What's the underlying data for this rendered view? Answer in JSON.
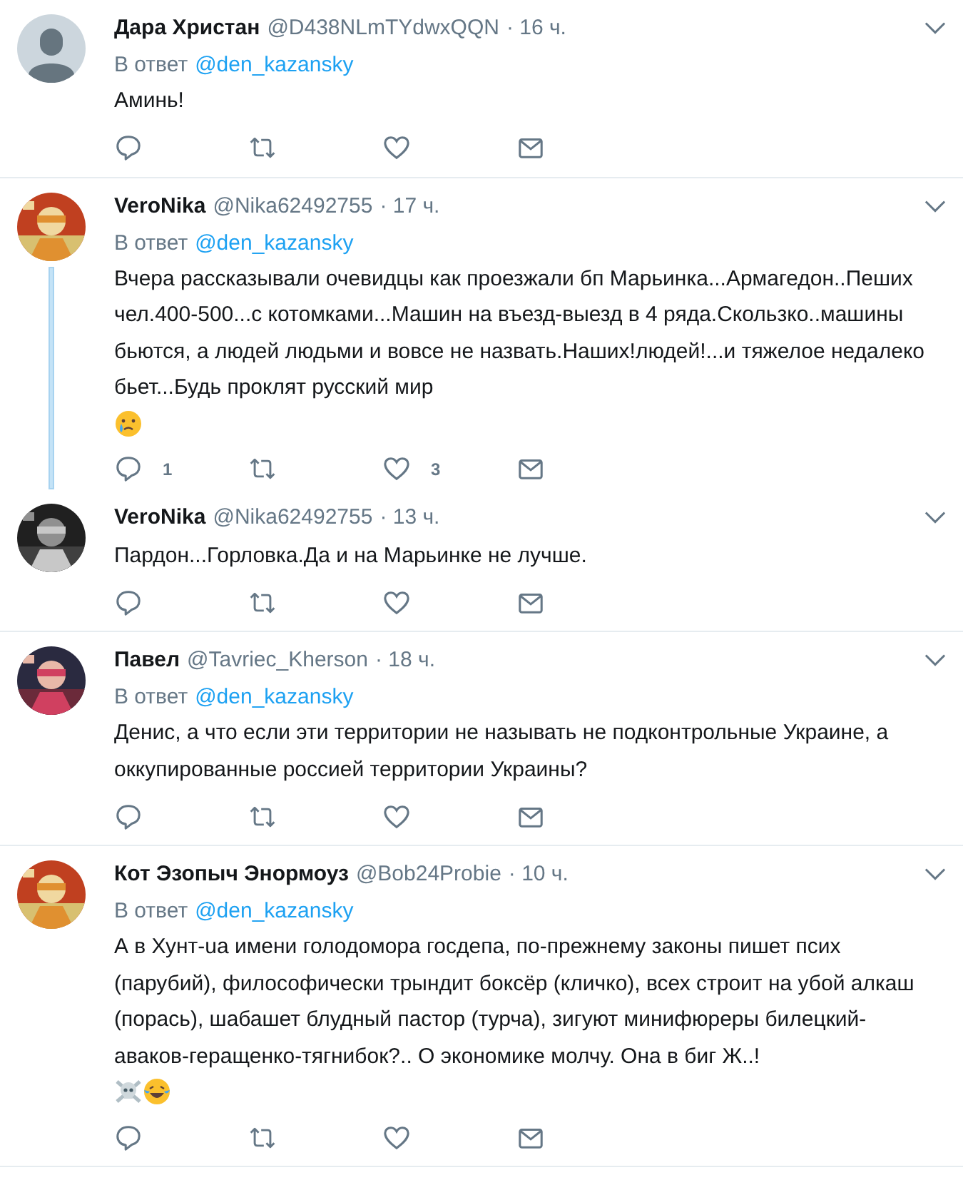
{
  "tweets": [
    {
      "avatar": {
        "kind": "default"
      },
      "name": "Дара Христан",
      "handle": "@D438NLmTYdwxQQN",
      "time": "· 16 ч.",
      "reply_label": "В ответ",
      "reply_to": "@den_kazansky",
      "text": "Аминь!",
      "thread_below": false
    },
    {
      "avatar": {
        "kind": "picture"
      },
      "name": "VeroNika",
      "handle": "@Nika62492755",
      "time": "· 17 ч.",
      "reply_label": "В ответ",
      "reply_to": "@den_kazansky",
      "text": "Вчера рассказывали очевидцы как проезжали бп Марьинка...Армагедон..Пеших чел.400-500...с котомками...Машин на въезд-выезд в 4 ряда.Скользко..машины бьются, а людей людьми и вовсе не назвать.Наших!людей!...и тяжелое недалеко бьет...Будь проклят русский мир",
      "emojis": [
        {
          "kind": "crying"
        }
      ],
      "reply_count": "1",
      "like_count": "3",
      "thread_below": true
    },
    {
      "avatar": {
        "kind": "picture"
      },
      "name": "VeroNika",
      "handle": "@Nika62492755",
      "time": "· 13 ч.",
      "text": "Пардон...Горловка.Да и на Марьинке не лучше.",
      "thread_below": false
    },
    {
      "avatar": {
        "kind": "picture"
      },
      "name": "Павел",
      "handle": "@Tavriec_Kherson",
      "time": "· 18 ч.",
      "reply_label": "В ответ",
      "reply_to": "@den_kazansky",
      "text": "Денис, а что если эти территории не называть не подконтрольные Украине, а оккупированные россией территории Украины?",
      "thread_below": false
    },
    {
      "avatar": {
        "kind": "picture"
      },
      "name": "Кот Эзопыч Энормоуз",
      "handle": "@Bob24Probie",
      "time": "· 10 ч.",
      "reply_label": "В ответ",
      "reply_to": "@den_kazansky",
      "text": "А в Хунт-ua имени голодомора госдепа, по-прежнему законы пишет псих (парубий), философически трындит боксёр (кличко), всех строит на убой алкаш (порась), шабашет блудный пастор (турча), зигуют минифюреры билецкий-аваков-геращенко-тягнибок?.. О экономике молчу. Она в биг Ж..!",
      "emojis": [
        {
          "kind": "skull"
        },
        {
          "kind": "laughing"
        }
      ],
      "thread_below": false
    }
  ]
}
